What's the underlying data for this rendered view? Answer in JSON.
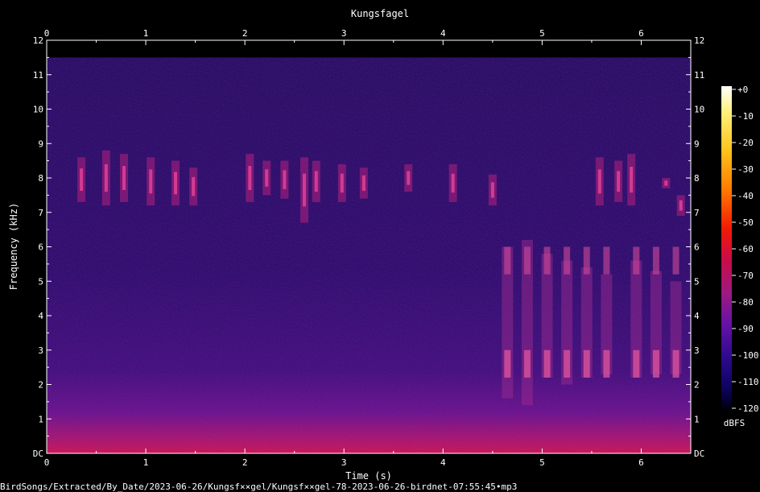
{
  "chart_data": {
    "type": "heatmap",
    "title": "Kungsfagel",
    "xlabel": "Time (s)",
    "ylabel": "Frequency (kHz)",
    "xlim": [
      0,
      6.5
    ],
    "ylim": [
      0,
      12
    ],
    "x_ticks": [
      "0",
      "1",
      "2",
      "3",
      "4",
      "5",
      "6"
    ],
    "y_ticks": [
      "DC",
      "1",
      "2",
      "3",
      "4",
      "5",
      "6",
      "7",
      "8",
      "9",
      "10",
      "11",
      "12"
    ],
    "colorbar": {
      "label": "dBFS",
      "range": [
        -120,
        0
      ],
      "ticks": [
        "+0",
        "-10",
        "-20",
        "-30",
        "-40",
        "-50",
        "-60",
        "-70",
        "-80",
        "-90",
        "-100",
        "-110",
        "-120"
      ],
      "colors": [
        "#ffffff",
        "#fff07a",
        "#ffc21a",
        "#ff7a00",
        "#f21a05",
        "#c80c4a",
        "#9c1a82",
        "#6212a6",
        "#2c0a8c",
        "#120466",
        "#050036",
        "#000000"
      ]
    },
    "signal_energy_fraction_above_cutoff": 0,
    "upper_cutoff_khz": 11.5,
    "background_colors": {
      "high_band": "#1b0a5e",
      "mid_band": "#2a0c6e",
      "low_band": "#5a0f8a",
      "dc_band": "#c01060"
    },
    "call_marks": [
      {
        "t": 0.35,
        "f_low": 7.3,
        "f_high": 8.6
      },
      {
        "t": 0.6,
        "f_low": 7.2,
        "f_high": 8.8
      },
      {
        "t": 0.78,
        "f_low": 7.3,
        "f_high": 8.7
      },
      {
        "t": 1.05,
        "f_low": 7.2,
        "f_high": 8.6
      },
      {
        "t": 1.3,
        "f_low": 7.2,
        "f_high": 8.5
      },
      {
        "t": 1.48,
        "f_low": 7.2,
        "f_high": 8.3
      },
      {
        "t": 2.05,
        "f_low": 7.3,
        "f_high": 8.7
      },
      {
        "t": 2.22,
        "f_low": 7.5,
        "f_high": 8.5
      },
      {
        "t": 2.4,
        "f_low": 7.4,
        "f_high": 8.5
      },
      {
        "t": 2.6,
        "f_low": 6.7,
        "f_high": 8.6
      },
      {
        "t": 2.72,
        "f_low": 7.3,
        "f_high": 8.5
      },
      {
        "t": 2.98,
        "f_low": 7.3,
        "f_high": 8.4
      },
      {
        "t": 3.2,
        "f_low": 7.4,
        "f_high": 8.3
      },
      {
        "t": 3.65,
        "f_low": 7.6,
        "f_high": 8.4
      },
      {
        "t": 4.1,
        "f_low": 7.3,
        "f_high": 8.4
      },
      {
        "t": 4.5,
        "f_low": 7.2,
        "f_high": 8.1
      },
      {
        "t": 5.58,
        "f_low": 7.2,
        "f_high": 8.6
      },
      {
        "t": 5.77,
        "f_low": 7.3,
        "f_high": 8.5
      },
      {
        "t": 5.9,
        "f_low": 7.2,
        "f_high": 8.7
      },
      {
        "t": 6.25,
        "f_low": 7.7,
        "f_high": 8.0
      },
      {
        "t": 6.4,
        "f_low": 6.9,
        "f_high": 7.5
      }
    ],
    "low_calls": [
      {
        "t": 4.65,
        "f_low": 1.6,
        "f_high": 6.0
      },
      {
        "t": 4.85,
        "f_low": 1.4,
        "f_high": 6.2
      },
      {
        "t": 5.05,
        "f_low": 2.2,
        "f_high": 5.8
      },
      {
        "t": 5.25,
        "f_low": 2.0,
        "f_high": 5.6
      },
      {
        "t": 5.45,
        "f_low": 2.2,
        "f_high": 5.4
      },
      {
        "t": 5.65,
        "f_low": 2.3,
        "f_high": 5.2
      },
      {
        "t": 5.95,
        "f_low": 2.2,
        "f_high": 5.6
      },
      {
        "t": 6.15,
        "f_low": 2.3,
        "f_high": 5.3
      },
      {
        "t": 6.35,
        "f_low": 2.3,
        "f_high": 5.0
      }
    ]
  },
  "file_path": "BirdSongs/Extracted/By_Date/2023-06-26/Kungsf××gel/Kungsf××gel-78-2023-06-26-birdnet-07:55:45•mp3"
}
